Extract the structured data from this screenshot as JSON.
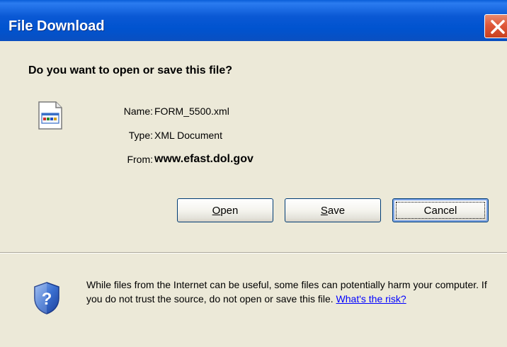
{
  "window": {
    "title": "File Download"
  },
  "dialog": {
    "question": "Do you want to open or save this file?",
    "fields": [
      {
        "label": "Name:",
        "value": "FORM_5500.xml"
      },
      {
        "label": "Type:",
        "value": "XML Document"
      },
      {
        "label": "From:",
        "value": "www.efast.dol.gov"
      }
    ],
    "buttons": {
      "open": {
        "accel": "O",
        "rest": "pen"
      },
      "save": {
        "accel": "S",
        "rest": "ave"
      },
      "cancel": "Cancel"
    },
    "warning_text": "While files from the Internet can be useful, some files can potentially harm your computer. If you do not trust the source, do not open or save this file.",
    "risk_link": "What's the risk?"
  },
  "icons": {
    "close": "close-icon",
    "file": "xml-document-icon",
    "warning": "security-shield-icon"
  },
  "colors": {
    "titlebar": "#0054e3",
    "dialog_bg": "#ece9d8",
    "close_button": "#e0583a",
    "link": "#0000ff"
  }
}
